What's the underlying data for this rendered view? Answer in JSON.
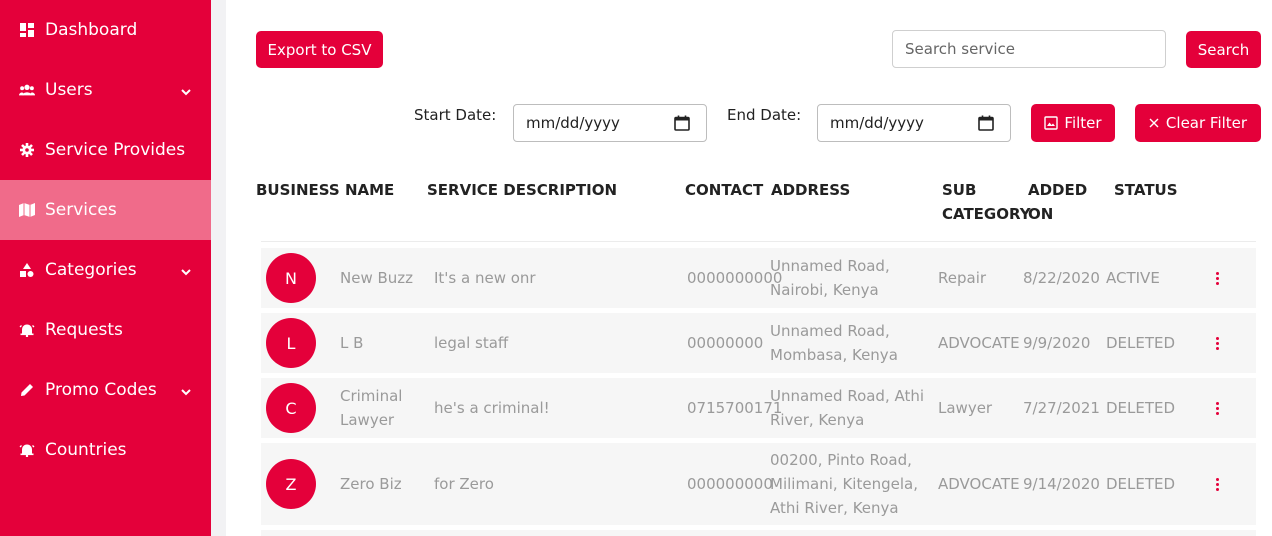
{
  "sidebar": {
    "items": [
      {
        "label": "Dashboard",
        "icon": "dashboard-icon",
        "has_chevron": false,
        "active": false
      },
      {
        "label": "Users",
        "icon": "users-icon",
        "has_chevron": true,
        "active": false
      },
      {
        "label": "Service Provides",
        "icon": "gear-icon",
        "has_chevron": false,
        "active": false
      },
      {
        "label": "Services",
        "icon": "map-icon",
        "has_chevron": false,
        "active": true
      },
      {
        "label": "Categories",
        "icon": "shapes-icon",
        "has_chevron": true,
        "active": false
      },
      {
        "label": "Requests",
        "icon": "bell-icon",
        "has_chevron": false,
        "active": false
      },
      {
        "label": "Promo Codes",
        "icon": "pencil-icon",
        "has_chevron": true,
        "active": false
      },
      {
        "label": "Countries",
        "icon": "bell-icon",
        "has_chevron": false,
        "active": false
      }
    ]
  },
  "toolbar": {
    "export_label": "Export to CSV",
    "search_placeholder": "Search service",
    "search_label": "Search",
    "start_date_label": "Start Date:",
    "start_date_value": "mm/dd/yyyy",
    "end_date_label": "End Date:",
    "end_date_value": "mm/dd/yyyy",
    "filter_label": "Filter",
    "clear_filter_label": "Clear Filter"
  },
  "table": {
    "headers": {
      "business_name": "BUSINESS NAME",
      "service_description": "SERVICE DESCRIPTION",
      "contact": "CONTACT",
      "address": "ADDRESS",
      "sub_category_1": "SUB",
      "sub_category_2": "CATEGORY",
      "added_on_1": "ADDED",
      "added_on_2": "ON",
      "status": "STATUS"
    },
    "rows": [
      {
        "initial": "N",
        "name": "New Buzz",
        "description": "It's a new onr",
        "contact": "0000000000",
        "address": "Unnamed Road, Nairobi, Kenya",
        "sub_category": "Repair",
        "added_on": "8/22/2020",
        "status": "ACTIVE"
      },
      {
        "initial": "L",
        "name": "L B",
        "description": "legal staff",
        "contact": "00000000",
        "address": "Unnamed Road, Mombasa, Kenya",
        "sub_category": "ADVOCATE",
        "added_on": "9/9/2020",
        "status": "DELETED"
      },
      {
        "initial": "C",
        "name": "Criminal Lawyer",
        "description": "he's a criminal!",
        "contact": "0715700171",
        "address": "Unnamed Road, Athi River, Kenya",
        "sub_category": "Lawyer",
        "added_on": "7/27/2021",
        "status": "DELETED"
      },
      {
        "initial": "Z",
        "name": "Zero Biz",
        "description": "for Zero",
        "contact": "000000000",
        "address": "00200, Pinto Road, Milimani, Kitengela, Athi River, Kenya",
        "sub_category": "ADVOCATE",
        "added_on": "9/14/2020",
        "status": "DELETED"
      }
    ]
  },
  "colors": {
    "brand": "#e4003a",
    "sidebar_active": "#f06b8a",
    "row_background": "#f6f6f6",
    "muted_text": "#9a9a9a"
  }
}
